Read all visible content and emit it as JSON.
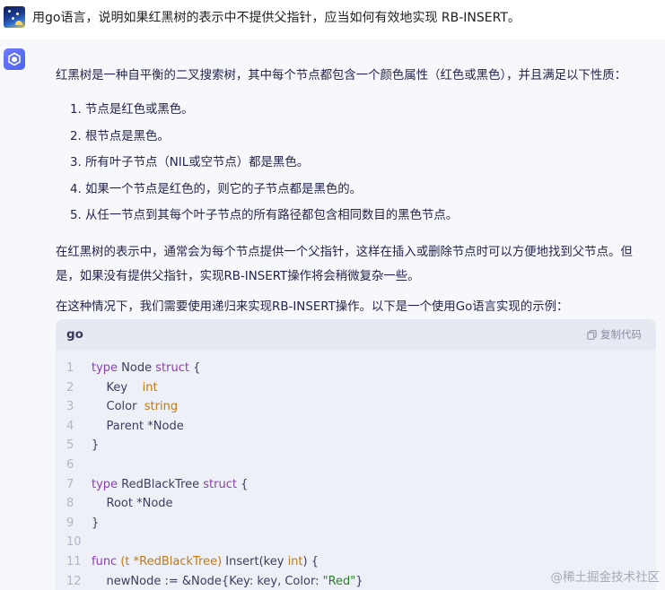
{
  "question": {
    "text": "用go语言，说明如果红黑树的表示中不提供父指针，应当如何有效地实现 RB-INSERT。"
  },
  "answer": {
    "intro": "红黑树是一种自平衡的二叉搜索树，其中每个节点都包含一个颜色属性（红色或黑色），并且满足以下性质：",
    "properties": [
      "1. 节点是红色或黑色。",
      "2. 根节点是黑色。",
      "3. 所有叶子节点（NIL或空节点）都是黑色。",
      "4. 如果一个节点是红色的，则它的子节点都是黑色的。",
      "5. 从任一节点到其每个叶子节点的所有路径都包含相同数目的黑色节点。"
    ],
    "para2_line1": "在红黑树的表示中，通常会为每个节点提供一个父指针，这样在插入或删除节点时可以方便地找到父节点。但",
    "para2_line2": "是，如果没有提供父指针，实现RB-INSERT操作将会稍微复杂一些。",
    "para3": "在这种情况下，我们需要使用递归来实现RB-INSERT操作。以下是一个使用Go语言实现的示例："
  },
  "code_block": {
    "language": "go",
    "copy_label": "复制代码",
    "line_numbers": [
      "1",
      "2",
      "3",
      "4",
      "5",
      "6",
      "7",
      "8",
      "9",
      "10",
      "11",
      "12"
    ],
    "l1": {
      "kw1": "type",
      "name": " Node ",
      "kw2": "struct",
      "rest": " {"
    },
    "l2": {
      "field": "    Key    ",
      "type": "int"
    },
    "l3": {
      "field": "    Color  ",
      "type": "string"
    },
    "l4": {
      "field": "    Parent *Node"
    },
    "l5": {
      "text": "}"
    },
    "l7": {
      "kw1": "type",
      "name": " RedBlackTree ",
      "kw2": "struct",
      "rest": " {"
    },
    "l8": {
      "text": "    Root *Node"
    },
    "l9": {
      "text": "}"
    },
    "l11": {
      "kw": "func",
      "recv": " (t *RedBlackTree)",
      "sig": " Insert(key ",
      "type": "int",
      "end": ") {"
    },
    "l12": {
      "pre": "    newNode := &Node{Key: key, Color: ",
      "str": "\"Red\"",
      "end": "}"
    }
  },
  "watermark": "@稀土掘金技术社区",
  "colors": {
    "answer_bg": "#f7f8fc",
    "code_bg": "#eef0f7",
    "keyword": "#8a3fae",
    "type": "#c07a16",
    "string": "#2a7d2a"
  }
}
